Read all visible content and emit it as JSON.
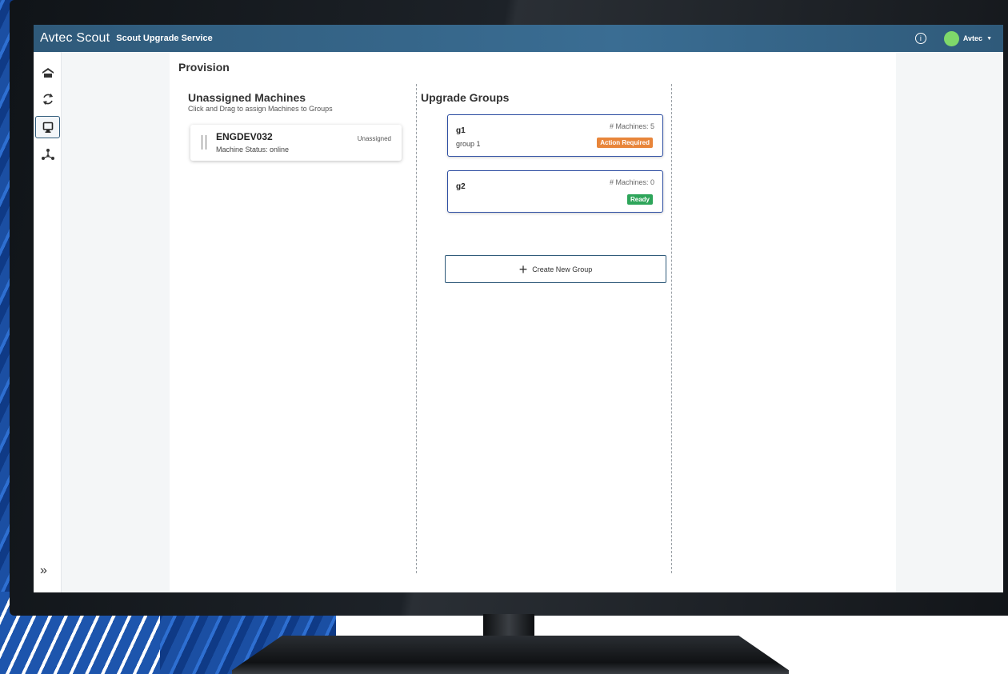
{
  "app": {
    "brand": "Avtec Scout",
    "service": "Scout Upgrade Service",
    "user_name": "Avtec",
    "info_symbol": "i",
    "caret_symbol": "▼"
  },
  "sidebar": {
    "items": [
      {
        "name": "home-icon"
      },
      {
        "name": "refresh-icon"
      },
      {
        "name": "monitor-icon",
        "active": true
      },
      {
        "name": "network-icon"
      }
    ],
    "expand_symbol": "»"
  },
  "page": {
    "title": "Provision"
  },
  "unassigned": {
    "title": "Unassigned Machines",
    "subtitle": "Click and Drag to assign Machines to Groups",
    "machines": [
      {
        "name": "ENGDEV032",
        "status": "Machine Status: online",
        "tag": "Unassigned"
      }
    ]
  },
  "groups": {
    "title": "Upgrade Groups",
    "items": [
      {
        "name": "g1",
        "description": "group 1",
        "count": "# Machines: 5",
        "badge": "Action Required",
        "badge_color": "#e8853a"
      },
      {
        "name": "g2",
        "description": "",
        "count": "# Machines: 0",
        "badge": "Ready",
        "badge_color": "#2ea55a"
      }
    ],
    "create_label": "Create New Group",
    "create_symbol": "+"
  },
  "colors": {
    "header": "#2f5a7a",
    "group_border": "#2d4ea3"
  }
}
